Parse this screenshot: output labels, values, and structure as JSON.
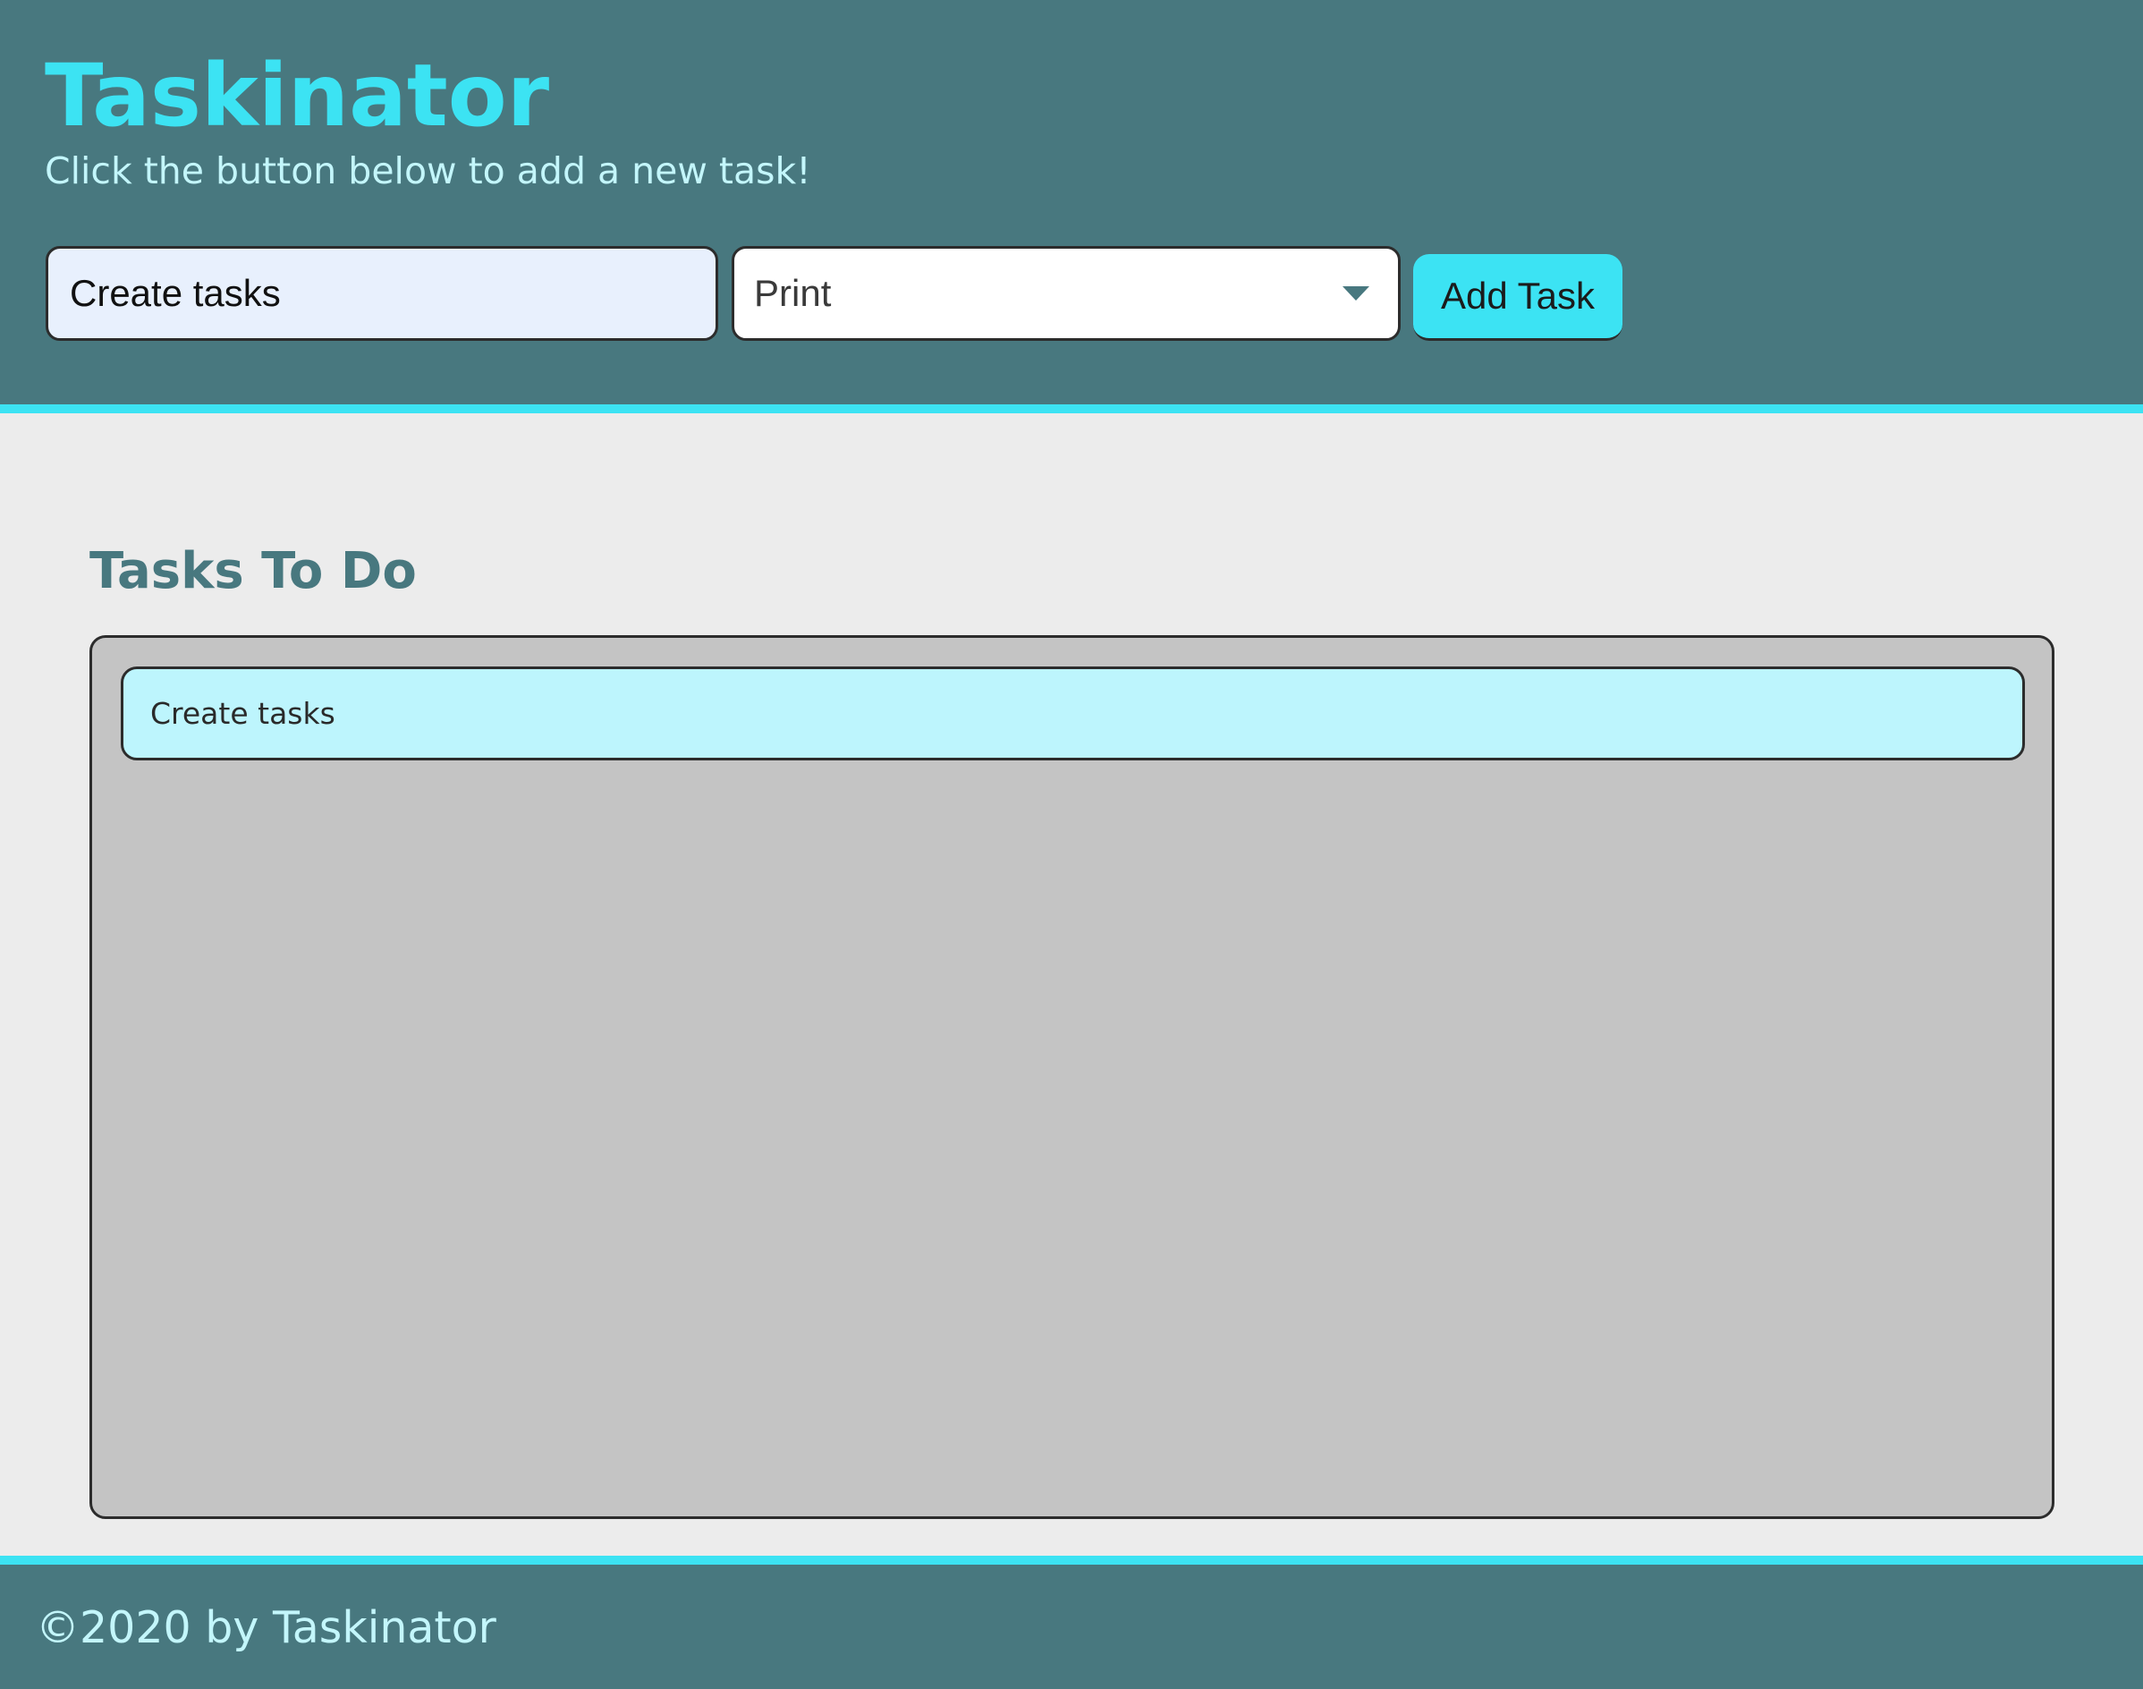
{
  "header": {
    "title": "Taskinator",
    "subtitle": "Click the button below to add a new task!"
  },
  "form": {
    "task_name_value": "Create tasks",
    "task_type_selected": "Print",
    "add_button_label": "Add Task"
  },
  "tasks_to_do": {
    "title": "Tasks To Do",
    "items": [
      {
        "name": "Create tasks"
      }
    ]
  },
  "footer": {
    "text": "©2020 by Taskinator"
  },
  "colors": {
    "header_bg": "#48787f",
    "accent": "#3ce3f3",
    "task_item_bg": "#bdf5fd",
    "task_list_bg": "#c4c4c4",
    "page_bg": "#ececec"
  },
  "icons": {
    "select_arrow": "chevron-down-icon"
  }
}
